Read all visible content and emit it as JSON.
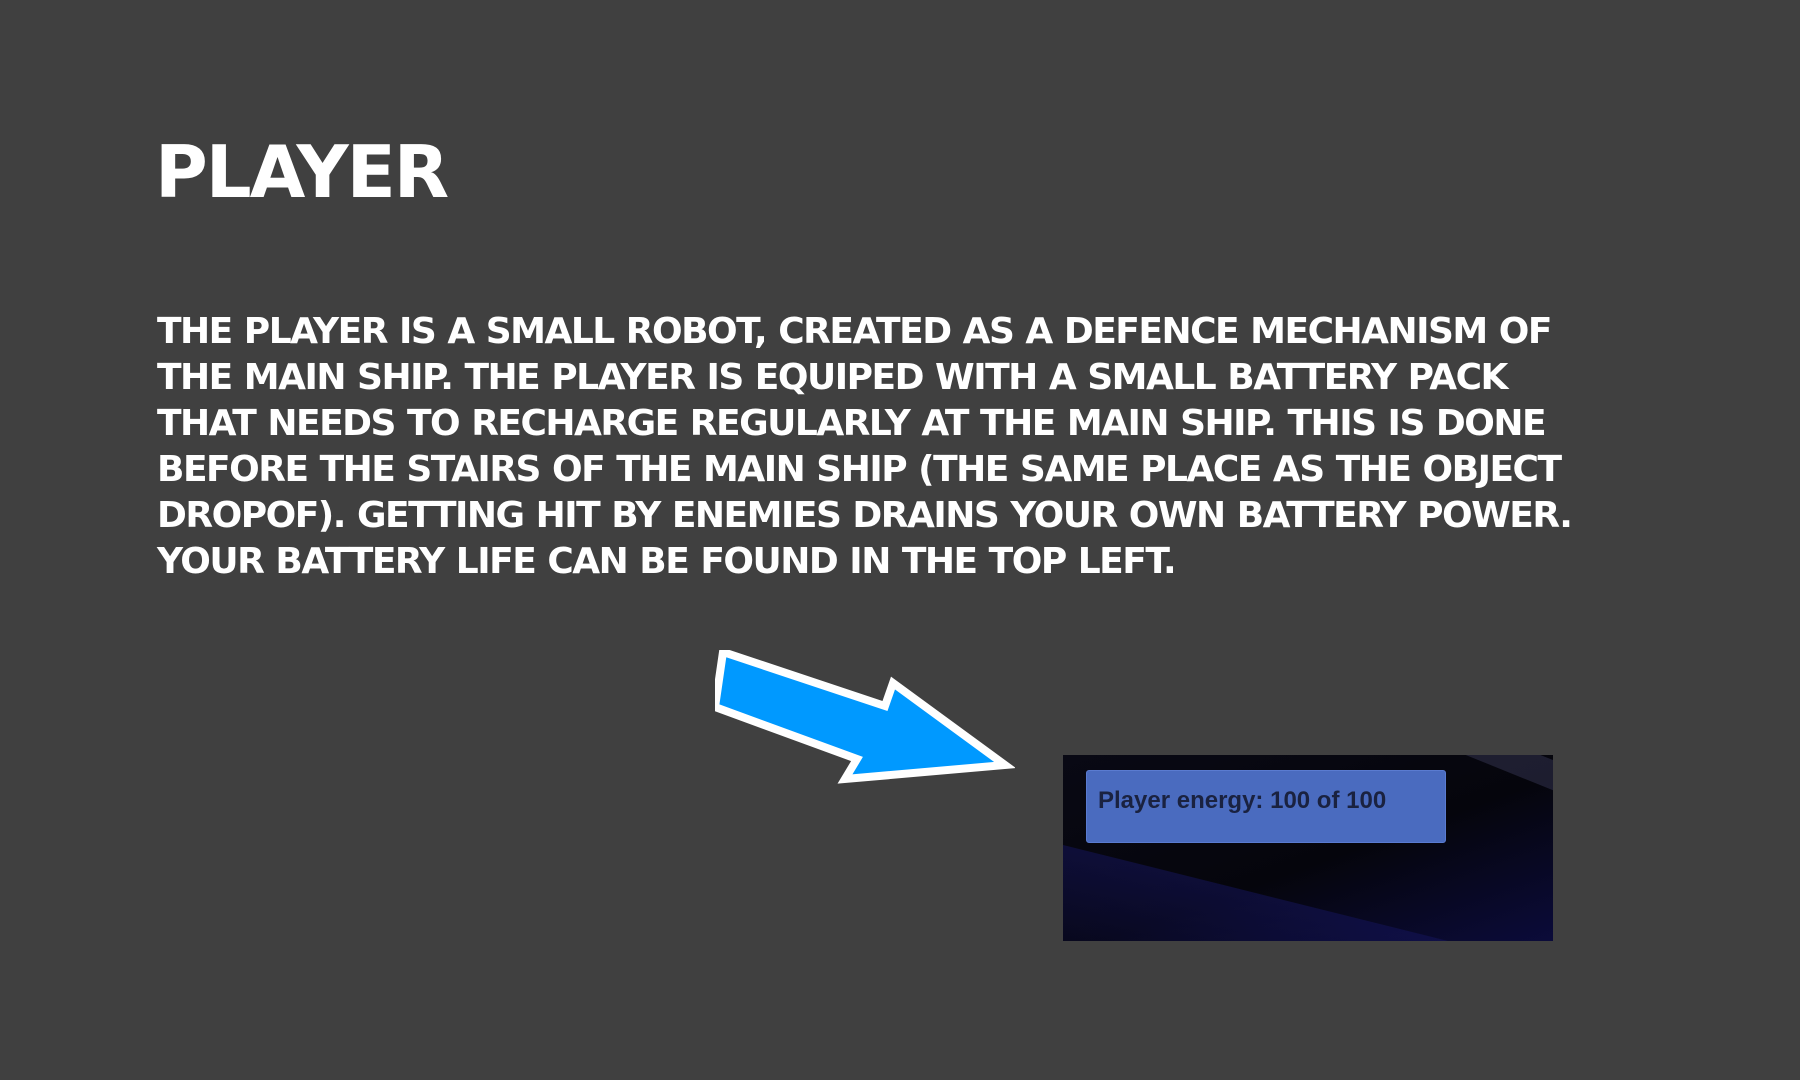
{
  "slide": {
    "title": "Player",
    "description": "The player is a small robot, created as a defence mechanism of the main ship. The player is equiped with a small battery pack that needs to recharge regularly  at the main ship. This is done before the stairs of the main ship (the same place as the object dropof). Getting hit by enemies drains your own battery power. Your battery life can be found in the top left."
  },
  "arrow": {
    "icon": "arrow-right-down-icon",
    "fill_color": "#0099ff",
    "outline_color": "#ffffff"
  },
  "game_screenshot": {
    "energy_label": "Player energy: 100 of 100",
    "panel_color": "#4a6bbf"
  },
  "colors": {
    "background": "#404040",
    "text": "#ffffff"
  }
}
